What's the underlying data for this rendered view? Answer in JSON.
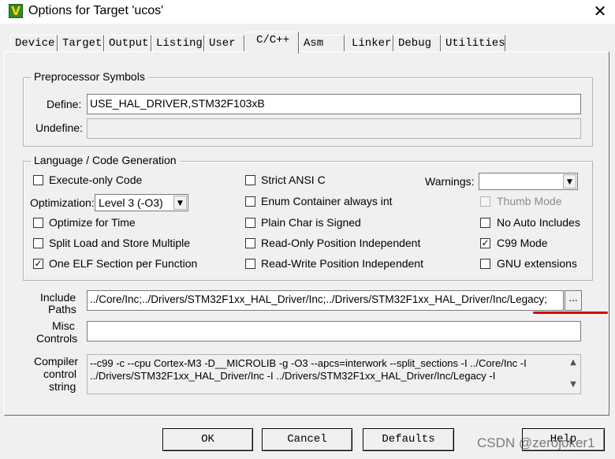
{
  "window": {
    "icon_glyph": "V",
    "title": "Options for Target 'ucos'",
    "close_glyph": "✕"
  },
  "tabs": [
    {
      "label": "Device",
      "active": false
    },
    {
      "label": "Target",
      "active": false
    },
    {
      "label": "Output",
      "active": false
    },
    {
      "label": "Listing",
      "active": false
    },
    {
      "label": "User",
      "active": false
    },
    {
      "label": "C/C++",
      "active": true
    },
    {
      "label": "Asm",
      "active": false
    },
    {
      "label": "Linker",
      "active": false
    },
    {
      "label": "Debug",
      "active": false
    },
    {
      "label": "Utilities",
      "active": false
    }
  ],
  "preprocessor": {
    "legend": "Preprocessor Symbols",
    "define_label": "Define:",
    "define_value": "USE_HAL_DRIVER,STM32F103xB",
    "undefine_label": "Undefine:",
    "undefine_value": ""
  },
  "language": {
    "legend": "Language / Code Generation",
    "execute_only": {
      "label": "Execute-only Code",
      "checked": false
    },
    "optimization_label": "Optimization:",
    "optimization_value": "Level 3 (-O3)",
    "optimize_time": {
      "label": "Optimize for Time",
      "checked": false
    },
    "split_load": {
      "label": "Split Load and Store Multiple",
      "checked": false
    },
    "one_elf": {
      "label": "One ELF Section per Function",
      "checked": true
    },
    "strict_ansi": {
      "label": "Strict ANSI C",
      "checked": false
    },
    "enum_container": {
      "label": "Enum Container always int",
      "checked": false
    },
    "plain_char": {
      "label": "Plain Char is Signed",
      "checked": false
    },
    "ro_pos_indep": {
      "label": "Read-Only Position Independent",
      "checked": false
    },
    "rw_pos_indep": {
      "label": "Read-Write Position Independent",
      "checked": false
    },
    "warnings_label": "Warnings:",
    "warnings_value": "",
    "thumb_mode": {
      "label": "Thumb Mode",
      "checked": false
    },
    "no_auto_includes": {
      "label": "No Auto Includes",
      "checked": false
    },
    "c99_mode": {
      "label": "C99 Mode",
      "checked": true
    },
    "gnu_extensions": {
      "label": "GNU extensions",
      "checked": false
    }
  },
  "paths": {
    "include_label_1": "Include",
    "include_label_2": "Paths",
    "include_value": "../Core/Inc;../Drivers/STM32F1xx_HAL_Driver/Inc;../Drivers/STM32F1xx_HAL_Driver/Inc/Legacy;",
    "browse_label": "...",
    "misc_label_1": "Misc",
    "misc_label_2": "Controls",
    "misc_value": "",
    "compiler_label_1": "Compiler",
    "compiler_label_2": "control",
    "compiler_label_3": "string",
    "compiler_line_1": "--c99 -c --cpu Cortex-M3 -D__MICROLIB -g -O3 --apcs=interwork --split_sections -I ../Core/Inc -I",
    "compiler_line_2": "../Drivers/STM32F1xx_HAL_Driver/Inc -I ../Drivers/STM32F1xx_HAL_Driver/Inc/Legacy -I"
  },
  "buttons": {
    "ok": "OK",
    "cancel": "Cancel",
    "defaults": "Defaults",
    "help": "Help"
  },
  "watermark": "CSDN @zerojoker1",
  "colors": {
    "annotation_red": "#d40000"
  }
}
